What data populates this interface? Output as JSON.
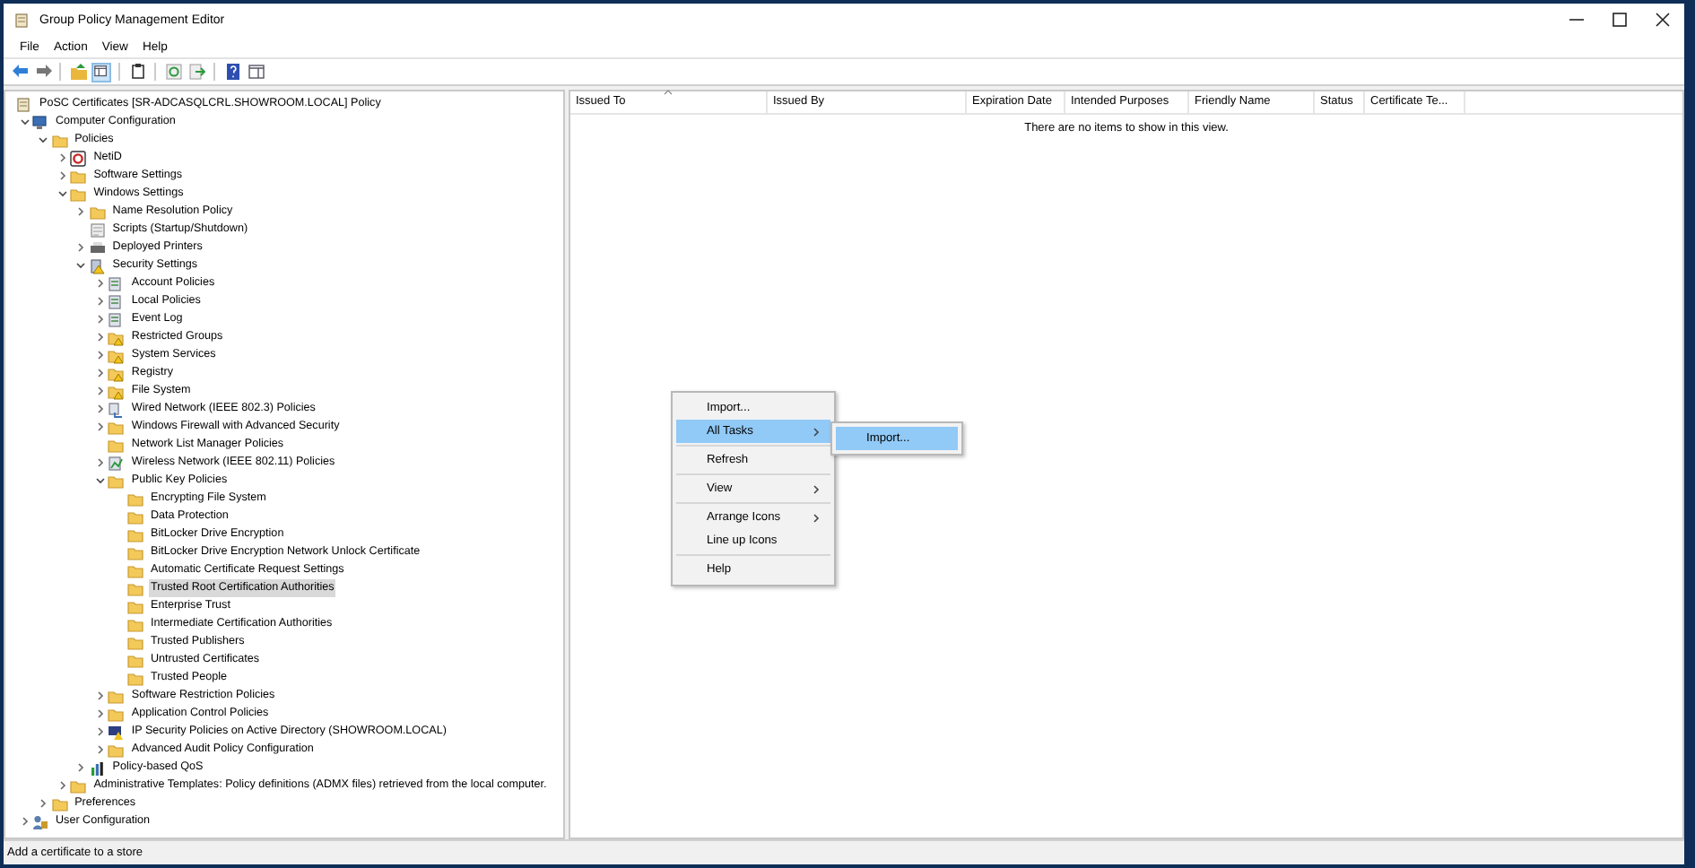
{
  "window": {
    "title": "Group Policy Management Editor"
  },
  "menu_bar": [
    "File",
    "Action",
    "View",
    "Help"
  ],
  "tree": {
    "label": "PoSC Certificates [SR-ADCASQLCRL.SHOWROOM.LOCAL] Policy",
    "kind": "policy",
    "selected": false,
    "children": [
      {
        "label": "Computer Configuration",
        "kind": "computer",
        "expanded": true,
        "selected": false,
        "children": [
          {
            "label": "Policies",
            "kind": "folder",
            "expanded": true,
            "selected": false,
            "children": [
              {
                "label": "NetiD",
                "kind": "netid",
                "expanded": false,
                "selected": false
              },
              {
                "label": "Software Settings",
                "kind": "folder",
                "expanded": false,
                "selected": false
              },
              {
                "label": "Windows Settings",
                "kind": "folder",
                "expanded": true,
                "selected": false,
                "children": [
                  {
                    "label": "Name Resolution Policy",
                    "kind": "folder",
                    "expanded": false,
                    "selected": false
                  },
                  {
                    "label": "Scripts (Startup/Shutdown)",
                    "kind": "scripts",
                    "selected": false
                  },
                  {
                    "label": "Deployed Printers",
                    "kind": "printer",
                    "expanded": false,
                    "selected": false
                  },
                  {
                    "label": "Security Settings",
                    "kind": "security",
                    "expanded": true,
                    "selected": false,
                    "children": [
                      {
                        "label": "Account Policies",
                        "kind": "policies",
                        "expanded": false,
                        "selected": false
                      },
                      {
                        "label": "Local Policies",
                        "kind": "policies",
                        "expanded": false,
                        "selected": false
                      },
                      {
                        "label": "Event Log",
                        "kind": "policies",
                        "expanded": false,
                        "selected": false
                      },
                      {
                        "label": "Restricted Groups",
                        "kind": "secure-folder",
                        "expanded": false,
                        "selected": false
                      },
                      {
                        "label": "System Services",
                        "kind": "secure-folder",
                        "expanded": false,
                        "selected": false
                      },
                      {
                        "label": "Registry",
                        "kind": "secure-folder",
                        "expanded": false,
                        "selected": false
                      },
                      {
                        "label": "File System",
                        "kind": "secure-folder",
                        "expanded": false,
                        "selected": false
                      },
                      {
                        "label": "Wired Network (IEEE 802.3) Policies",
                        "kind": "network",
                        "expanded": false,
                        "selected": false
                      },
                      {
                        "label": "Windows Firewall with Advanced Security",
                        "kind": "folder",
                        "expanded": false,
                        "selected": false
                      },
                      {
                        "label": "Network List Manager Policies",
                        "kind": "folder",
                        "selected": false
                      },
                      {
                        "label": "Wireless Network (IEEE 802.11) Policies",
                        "kind": "wireless",
                        "expanded": false,
                        "selected": false
                      },
                      {
                        "label": "Public Key Policies",
                        "kind": "folder",
                        "expanded": true,
                        "selected": false,
                        "children": [
                          {
                            "label": "Encrypting File System",
                            "kind": "folder",
                            "selected": false
                          },
                          {
                            "label": "Data Protection",
                            "kind": "folder",
                            "selected": false
                          },
                          {
                            "label": "BitLocker Drive Encryption",
                            "kind": "folder",
                            "selected": false
                          },
                          {
                            "label": "BitLocker Drive Encryption Network Unlock Certificate",
                            "kind": "folder",
                            "selected": false
                          },
                          {
                            "label": "Automatic Certificate Request Settings",
                            "kind": "folder",
                            "selected": false
                          },
                          {
                            "label": "Trusted Root Certification Authorities",
                            "kind": "folder",
                            "selected": true
                          },
                          {
                            "label": "Enterprise Trust",
                            "kind": "folder",
                            "selected": false
                          },
                          {
                            "label": "Intermediate Certification Authorities",
                            "kind": "folder",
                            "selected": false
                          },
                          {
                            "label": "Trusted Publishers",
                            "kind": "folder",
                            "selected": false
                          },
                          {
                            "label": "Untrusted Certificates",
                            "kind": "folder",
                            "selected": false
                          },
                          {
                            "label": "Trusted People",
                            "kind": "folder",
                            "selected": false
                          }
                        ]
                      },
                      {
                        "label": "Software Restriction Policies",
                        "kind": "folder",
                        "expanded": false,
                        "selected": false
                      },
                      {
                        "label": "Application Control Policies",
                        "kind": "folder",
                        "expanded": false,
                        "selected": false
                      },
                      {
                        "label": "IP Security Policies on Active Directory (SHOWROOM.LOCAL)",
                        "kind": "ipsec",
                        "expanded": false,
                        "selected": false
                      },
                      {
                        "label": "Advanced Audit Policy Configuration",
                        "kind": "folder",
                        "expanded": false,
                        "selected": false
                      }
                    ]
                  },
                  {
                    "label": "Policy-based QoS",
                    "kind": "qos",
                    "expanded": false,
                    "selected": false
                  }
                ]
              },
              {
                "label": "Administrative Templates: Policy definitions (ADMX files) retrieved from the local computer.",
                "kind": "folder",
                "expanded": false,
                "selected": false
              }
            ]
          },
          {
            "label": "Preferences",
            "kind": "folder",
            "expanded": false,
            "selected": false
          }
        ]
      },
      {
        "label": "User Configuration",
        "kind": "user",
        "expanded": false,
        "selected": false
      }
    ]
  },
  "list": {
    "columns": [
      {
        "label": "Issued To",
        "sorted": true
      },
      {
        "label": "Issued By",
        "sorted": false
      },
      {
        "label": "Expiration Date",
        "sorted": false
      },
      {
        "label": "Intended Purposes",
        "sorted": false
      },
      {
        "label": "Friendly Name",
        "sorted": false
      },
      {
        "label": "Status",
        "sorted": false
      },
      {
        "label": "Certificate Te...",
        "sorted": false
      }
    ],
    "empty_message": "There are no items to show in this view."
  },
  "context_menu": {
    "items": [
      {
        "kind": "item",
        "label": "Import...",
        "submenu": false,
        "selected": false
      },
      {
        "kind": "item",
        "label": "All Tasks",
        "submenu": true,
        "selected": true
      },
      {
        "kind": "separator"
      },
      {
        "kind": "item",
        "label": "Refresh",
        "submenu": false,
        "selected": false
      },
      {
        "kind": "separator"
      },
      {
        "kind": "item",
        "label": "View",
        "submenu": true,
        "selected": false
      },
      {
        "kind": "separator"
      },
      {
        "kind": "item",
        "label": "Arrange Icons",
        "submenu": true,
        "selected": false
      },
      {
        "kind": "item",
        "label": "Line up Icons",
        "submenu": false,
        "selected": false
      },
      {
        "kind": "separator"
      },
      {
        "kind": "item",
        "label": "Help",
        "submenu": false,
        "selected": false
      }
    ],
    "submenu": [
      {
        "kind": "item",
        "label": "Import...",
        "submenu": false,
        "selected": true
      }
    ]
  },
  "status_bar": "Add a certificate to a store"
}
